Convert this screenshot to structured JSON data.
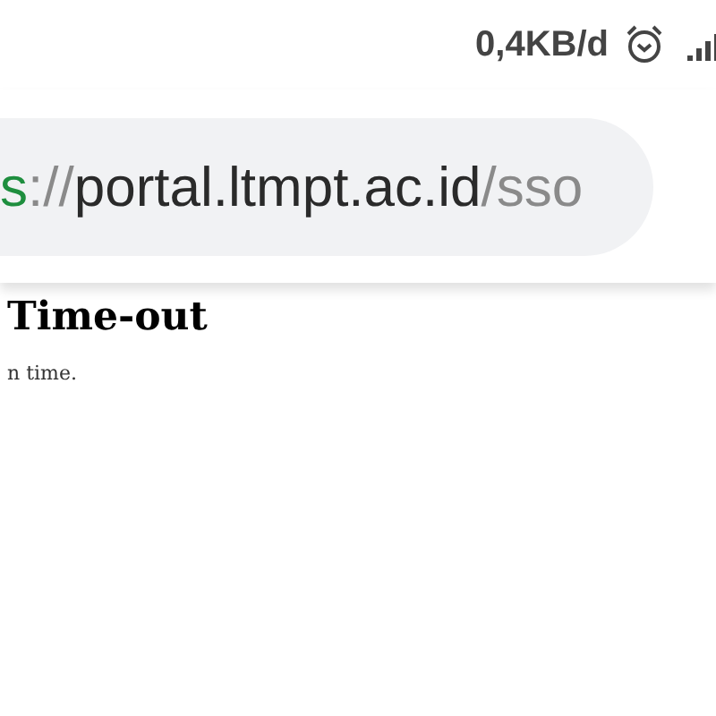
{
  "status_bar": {
    "speed": "0,4KB/d"
  },
  "address_bar": {
    "url_parts": [
      {
        "text": "s",
        "kind": "scheme"
      },
      {
        "text": "://",
        "kind": "muted"
      },
      {
        "text": "portal.ltmpt.ac.id",
        "kind": "host"
      },
      {
        "text": "/sso",
        "kind": "muted"
      }
    ]
  },
  "page": {
    "heading": "Time-out",
    "message": "n time."
  }
}
